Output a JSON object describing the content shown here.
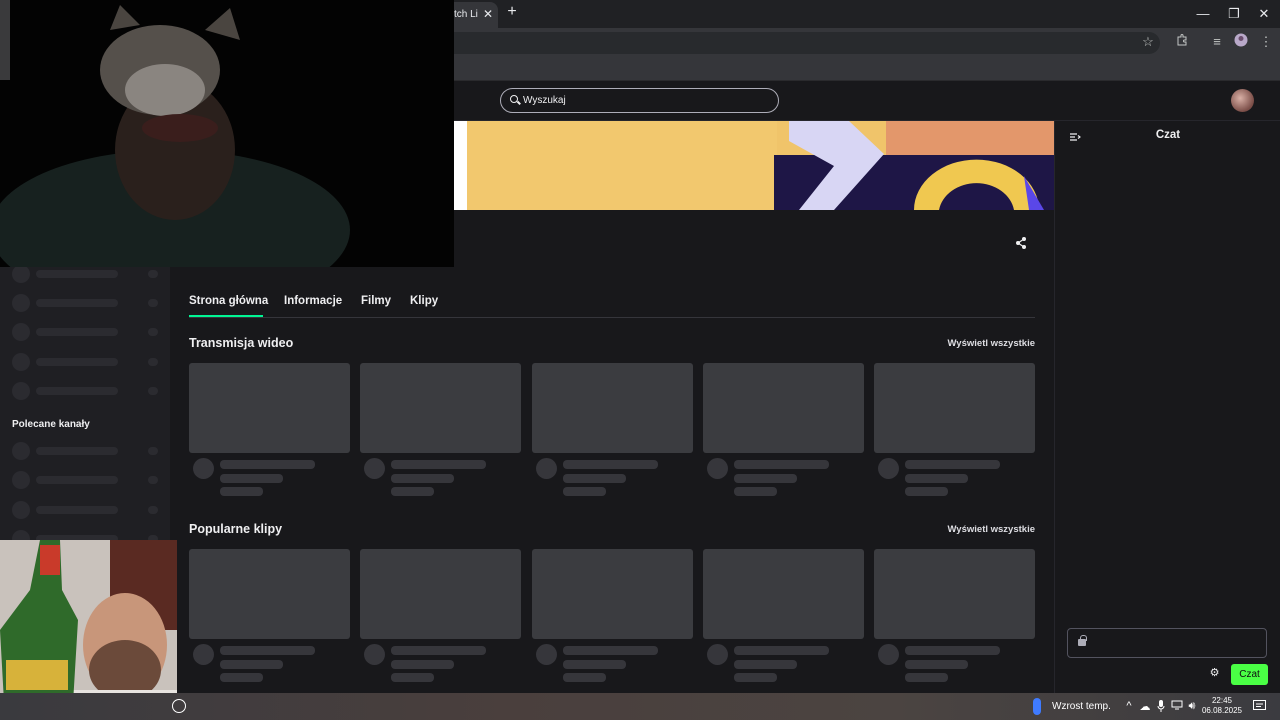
{
  "browser": {
    "tab_title": "tch Li",
    "tab_close": "✕",
    "new_tab": "+",
    "window_minimize": "—",
    "window_restore": "❐",
    "window_close": "✕"
  },
  "header": {
    "search_placeholder": "Wyszukaj"
  },
  "sidebar": {
    "recommended_heading": "Polecane kanały"
  },
  "channel_tabs": [
    {
      "label": "Strona główna"
    },
    {
      "label": "Informacje"
    },
    {
      "label": "Filmy"
    },
    {
      "label": "Klipy"
    }
  ],
  "sections": [
    {
      "title": "Transmisja wideo",
      "see_all": "Wyświetl wszystkie"
    },
    {
      "title": "Popularne klipy",
      "see_all": "Wyświetl wszystkie"
    }
  ],
  "chat": {
    "title": "Czat",
    "send_label": "Czat"
  },
  "taskbar": {
    "weather": "Wzrost temp.",
    "time": "22:45",
    "date": "06.08.2025"
  },
  "colors": {
    "accent_green": "#4aff45",
    "active_tab_underline": "#00f593",
    "background": "#18181b"
  }
}
